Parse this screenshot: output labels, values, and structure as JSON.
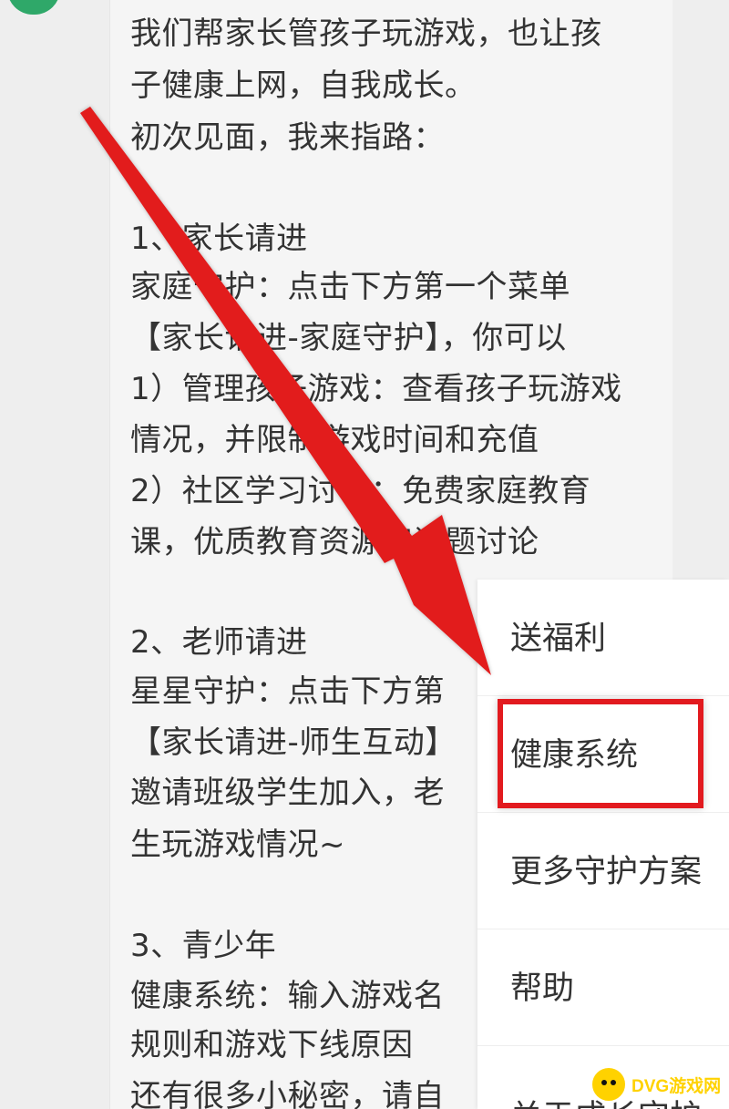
{
  "chat": {
    "message_lines": [
      "我们帮家长管孩子玩游戏，也让孩",
      "子健康上网，自我成长。",
      "初次见面，我来指路：",
      "1、家长请进",
      "家庭守护：点击下方第一个菜单",
      "【家长请进-家庭守护】，你可以",
      "1）管理孩子游戏：查看孩子玩游戏",
      "情况，并限制游戏时间和充值",
      "2）社区学习讨论：免费家庭教育",
      "课，优质教育资源和话题讨论",
      "2、老师请进",
      "星星守护：点击下方第",
      "【家长请进-师生互动】",
      "邀请班级学生加入，老",
      "生玩游戏情况~",
      "3、青少年",
      "健康系统：输入游戏名",
      "规则和游戏下线原因",
      "还有很多小秘密，请自"
    ]
  },
  "popup_menu": {
    "items": [
      "送福利",
      "健康系统",
      "更多守护方案",
      "帮助",
      "关于成长守护"
    ],
    "highlighted_item": "健康系统"
  },
  "annotation": {
    "arrow_color": "#e21a1f",
    "highlight_color": "#e21a1f"
  },
  "watermark": {
    "text": "DVG游戏网"
  },
  "icons": {
    "avatar": "green-avatar-fragment",
    "watermark_logo": "yellow-game-logo-icon"
  }
}
